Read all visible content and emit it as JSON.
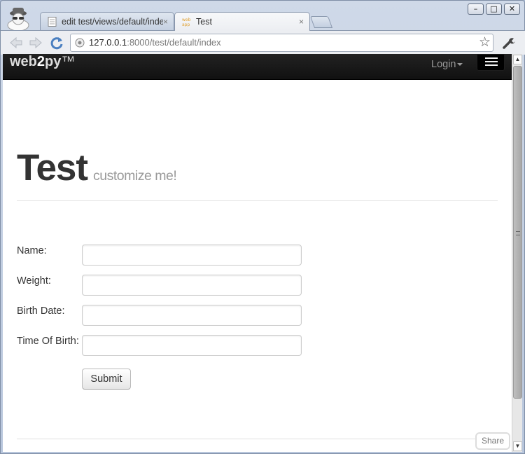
{
  "browser": {
    "tabs": [
      {
        "title": "edit test/views/default/index.html",
        "active": false,
        "favicon": "document-icon"
      },
      {
        "title": "Test",
        "active": true,
        "favicon": "web2py-app-icon"
      }
    ],
    "tab_close_glyph": "×",
    "address": {
      "host": "127.0.0.1",
      "path": ":8000/test/default/index"
    },
    "window_controls": [
      "–",
      "□",
      "✕"
    ],
    "bookmark_glyph": "☆"
  },
  "navbar": {
    "brand": {
      "part1": "web",
      "part2": "2",
      "part3": "py",
      "tm": "™"
    },
    "login_label": "Login"
  },
  "header": {
    "title": "Test",
    "subtitle": "customize me!"
  },
  "form": {
    "fields": [
      {
        "label": "Name:",
        "value": ""
      },
      {
        "label": "Weight:",
        "value": ""
      },
      {
        "label": "Birth Date:",
        "value": ""
      },
      {
        "label": "Time Of Birth:",
        "value": ""
      }
    ],
    "submit_label": "Submit"
  },
  "share_label": "Share",
  "colors": {
    "navbar": "#1b1b1b",
    "accent": "#999999"
  }
}
